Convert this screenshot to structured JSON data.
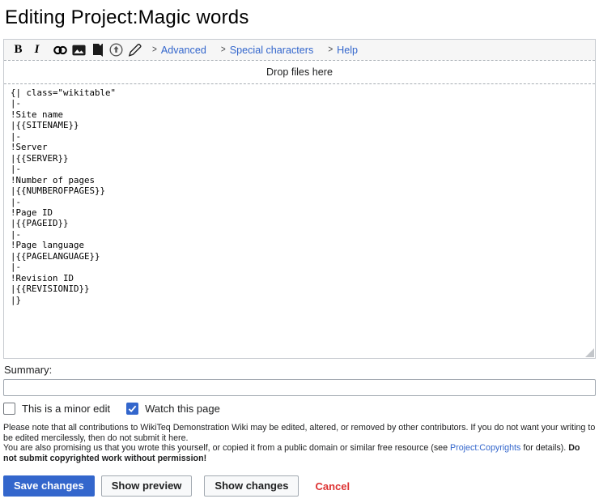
{
  "page": {
    "title": "Editing Project:Magic words"
  },
  "toolbar": {
    "bold_label": "B",
    "italic_label": "I",
    "chevron": ">",
    "icons": [
      "bold",
      "italic",
      "link-icon",
      "image-icon",
      "reference-book-icon",
      "upload-circle-icon",
      "signature-pencil-icon"
    ],
    "sections": [
      {
        "label": "Advanced"
      },
      {
        "label": "Special characters"
      },
      {
        "label": "Help"
      }
    ]
  },
  "dropzone": {
    "label": "Drop files here"
  },
  "editor": {
    "content": "{| class=\"wikitable\"\n|-\n!Site name\n|{{SITENAME}}\n|-\n!Server\n|{{SERVER}}\n|-\n!Number of pages\n|{{NUMBEROFPAGES}}\n|-\n!Page ID\n|{{PAGEID}}\n|-\n!Page language\n|{{PAGELANGUAGE}}\n|-\n!Revision ID\n|{{REVISIONID}}\n|}"
  },
  "summary": {
    "label": "Summary:",
    "value": "",
    "placeholder": ""
  },
  "options": {
    "minor_edit": {
      "label": "This is a minor edit",
      "checked": false
    },
    "watch": {
      "label": "Watch this page",
      "checked": true
    }
  },
  "legal": {
    "p1": "Please note that all contributions to WikiTeq Demonstration Wiki may be edited, altered, or removed by other contributors. If you do not want your writing to be edited mercilessly, then do not submit it here.",
    "p2_before_link": "You are also promising us that you wrote this yourself, or copied it from a public domain or similar free resource (see ",
    "p2_link": "Project:Copyrights",
    "p2_after_link": " for details). ",
    "p2_bold": "Do not submit copyrighted work without permission!"
  },
  "actions": {
    "save": "Save changes",
    "preview": "Show preview",
    "changes": "Show changes",
    "cancel": "Cancel"
  },
  "colors": {
    "link": "#3366cc",
    "progressive": "#3366cc",
    "destructive": "#d33333",
    "border": "#a2a9b1",
    "toolbar_bg": "#f6f6f6"
  }
}
